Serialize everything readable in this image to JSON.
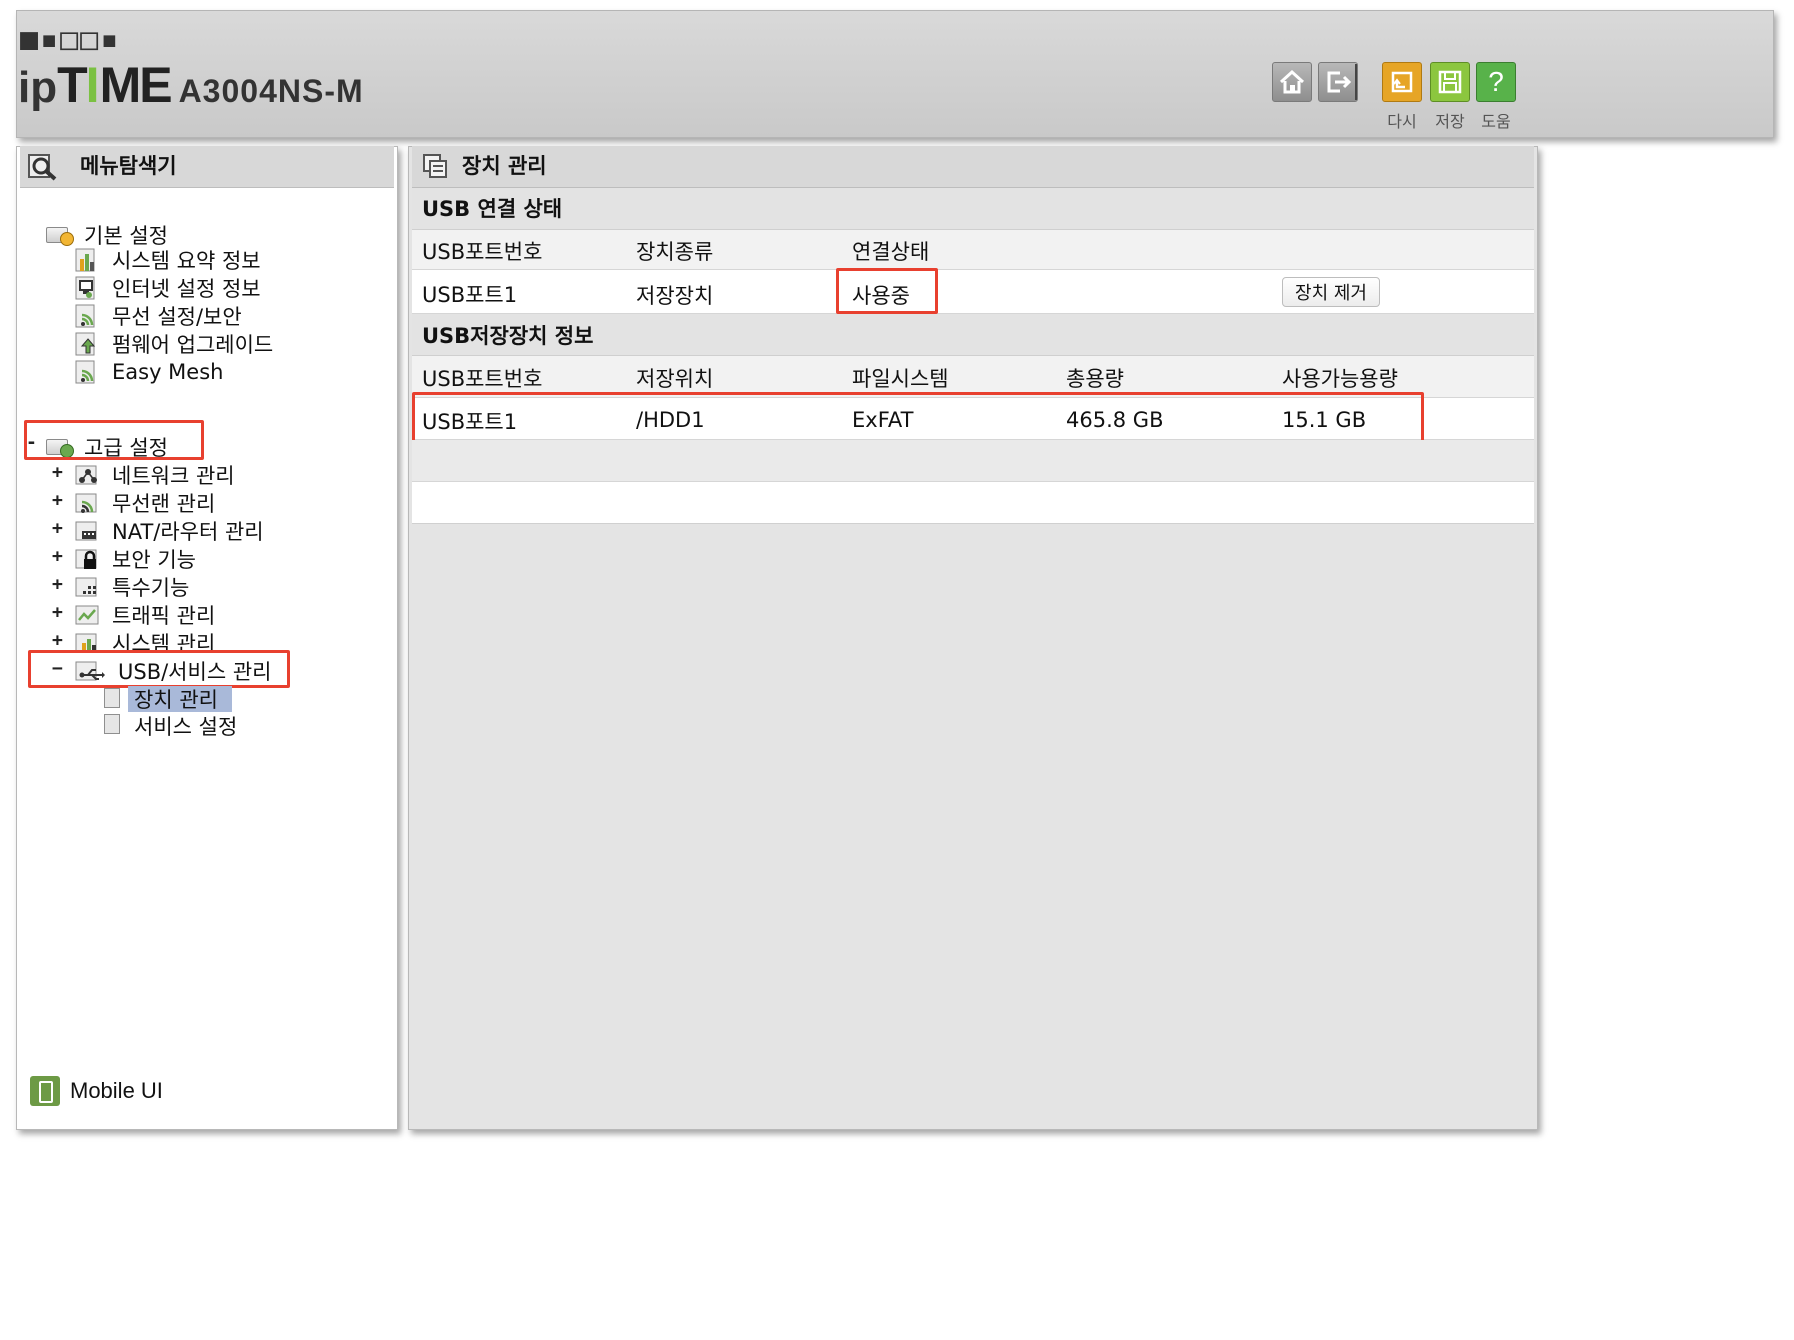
{
  "header": {
    "logo_top": "■▪□□▪",
    "logo_ip": "ip",
    "logo_t": "T",
    "logo_i": "I",
    "logo_me": "ME",
    "model": "A3004NS-M",
    "buttons": [
      {
        "icon": "home-icon",
        "label": ""
      },
      {
        "icon": "logout-icon",
        "label": ""
      },
      {
        "icon": "restart-icon",
        "label": "다시",
        "color": "#e6a526"
      },
      {
        "icon": "save-icon",
        "label": "저장",
        "color": "#8cc63f"
      },
      {
        "icon": "help-icon",
        "label": "도움",
        "color": "#58b24a",
        "glyph": "?"
      }
    ]
  },
  "sidebar": {
    "title": "메뉴탐색기",
    "basic": {
      "label": "기본 설정",
      "items": [
        "시스템 요약 정보",
        "인터넷 설정 정보",
        "무선 설정/보안",
        "펌웨어 업그레이드",
        "Easy Mesh"
      ]
    },
    "advanced": {
      "toggle": "-",
      "label": "고급 설정",
      "items": [
        {
          "toggle": "+",
          "label": "네트워크 관리"
        },
        {
          "toggle": "+",
          "label": "무선랜 관리"
        },
        {
          "toggle": "+",
          "label": "NAT/라우터 관리"
        },
        {
          "toggle": "+",
          "label": "보안 기능"
        },
        {
          "toggle": "+",
          "label": "특수기능"
        },
        {
          "toggle": "+",
          "label": "트래픽 관리"
        },
        {
          "toggle": "+",
          "label": "시스템 관리"
        },
        {
          "toggle": "−",
          "label": "USB/서비스 관리"
        }
      ],
      "usb_children": [
        "장치 관리",
        "서비스 설정"
      ]
    },
    "mobile_ui": "Mobile UI"
  },
  "main": {
    "title": "장치 관리",
    "usb_status": {
      "title": "USB 연결 상태",
      "columns": [
        "USB포트번호",
        "장치종류",
        "연결상태"
      ],
      "row": {
        "port": "USB포트1",
        "type": "저장장치",
        "status": "사용중",
        "action": "장치 제거"
      }
    },
    "storage_info": {
      "title": "USB저장장치 정보",
      "columns": [
        "USB포트번호",
        "저장위치",
        "파일시스템",
        "총용량",
        "사용가능용량"
      ],
      "row": {
        "port": "USB포트1",
        "location": "/HDD1",
        "filesystem": "ExFAT",
        "total": "465.8 GB",
        "available": "15.1 GB"
      }
    }
  },
  "colors": {
    "highlight_red": "#e8402f",
    "selected_blue": "#a9b9d9",
    "panel_gray": "#e4e4e4"
  }
}
